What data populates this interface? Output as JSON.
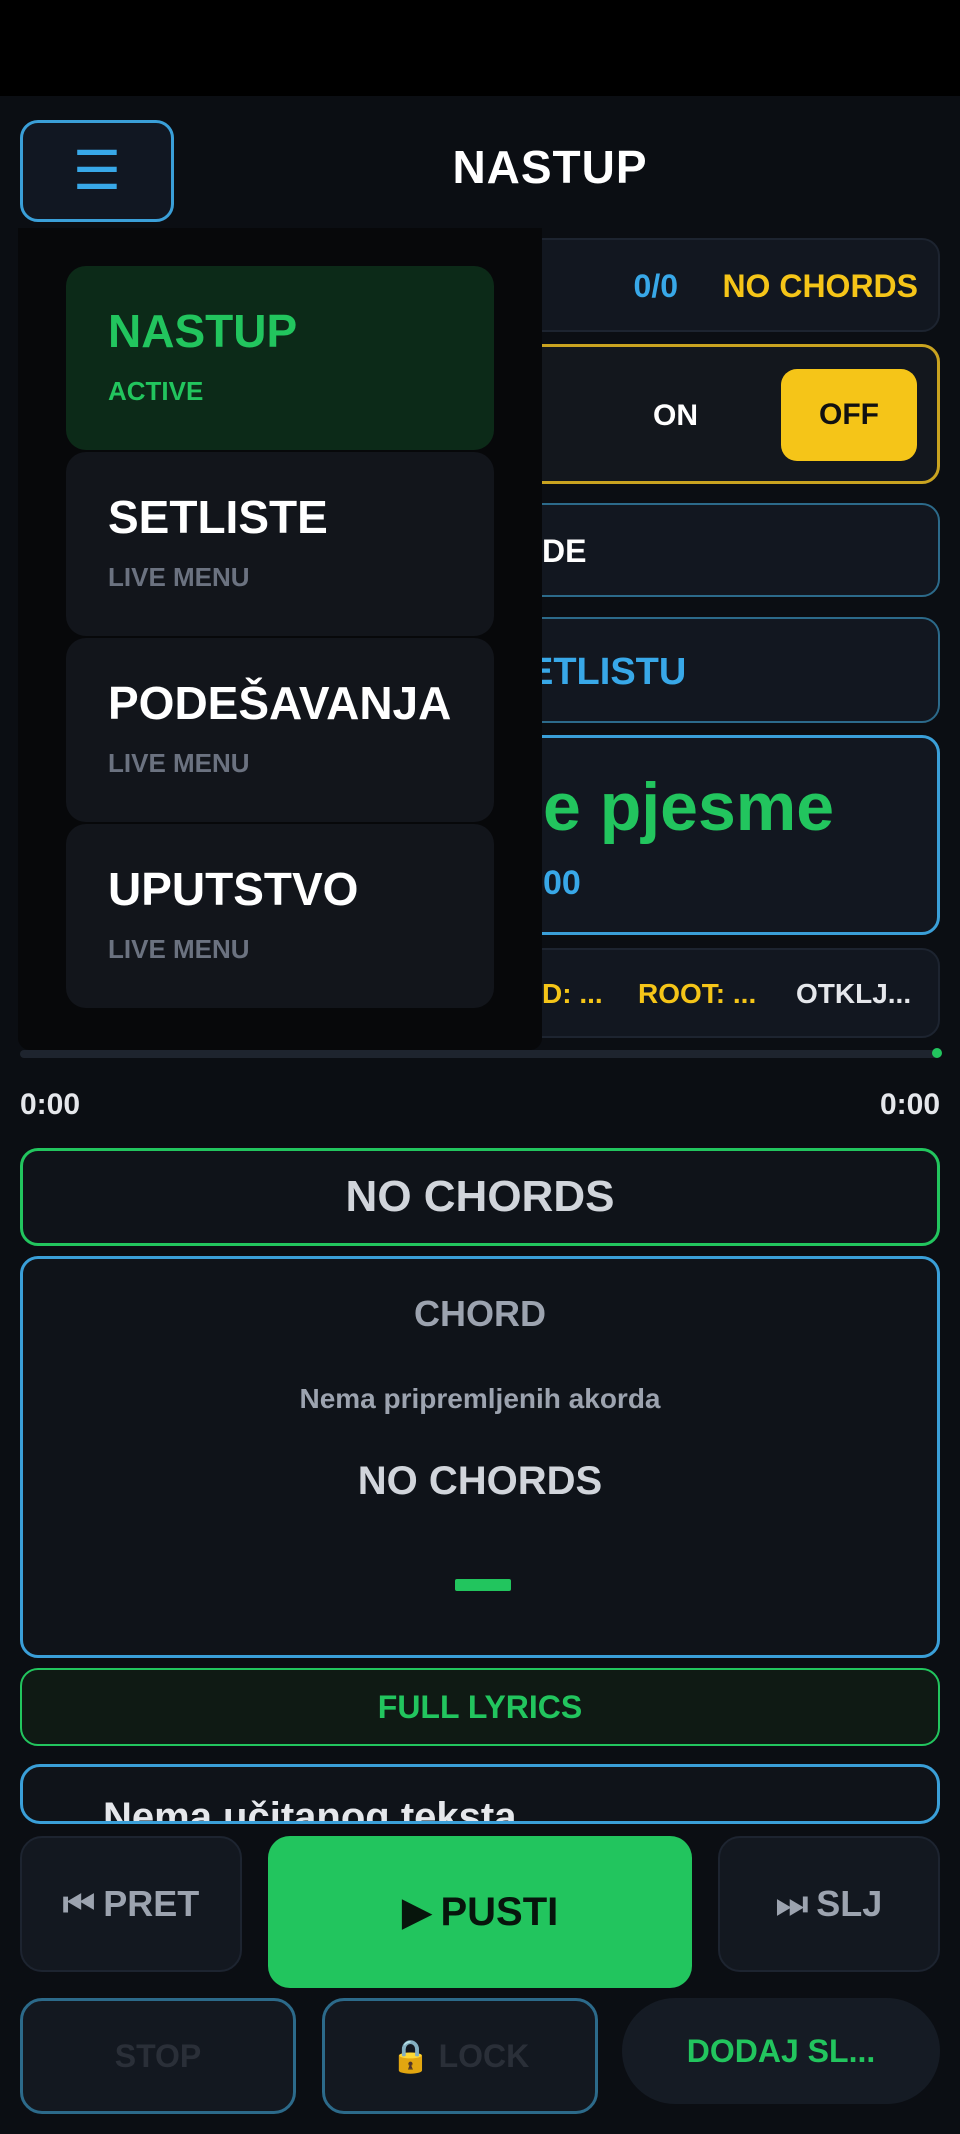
{
  "header": {
    "title": "NASTUP",
    "menu_icon": "hamburger-icon"
  },
  "status": {
    "count": "0/0",
    "no_chords": "NO CHORDS"
  },
  "toggle": {
    "on_label": "ON",
    "off_label": "OFF",
    "selected": "OFF"
  },
  "partial": {
    "mode_text": "DE",
    "setlist_text": "ETLISTU",
    "song_title_text": "e pjesme",
    "song_time_text": "00",
    "info_a": "D: ...",
    "info_b": "ROOT: ...",
    "info_c": "OTKLJ..."
  },
  "timer": {
    "current": "0:00",
    "total": "0:00"
  },
  "chords": {
    "bar_label": "NO CHORDS",
    "box_label": "CHORD",
    "box_sub": "Nema pripremljenih akorda",
    "box_big": "NO CHORDS"
  },
  "lyrics": {
    "button_label": "FULL LYRICS",
    "preview_text": "Nema učitanog teksta"
  },
  "controls": {
    "prev_label": "PRET",
    "play_label": "PUSTI",
    "next_label": "SLJ",
    "stop_label": "STOP",
    "lock_label": "LOCK",
    "add_label": "DODAJ SL..."
  },
  "drawer": {
    "items": [
      {
        "title": "NASTUP",
        "subtitle": "ACTIVE"
      },
      {
        "title": "SETLISTE",
        "subtitle": "LIVE MENU"
      },
      {
        "title": "PODEŠAVANJA",
        "subtitle": "LIVE MENU"
      },
      {
        "title": "UPUTSTVO",
        "subtitle": "LIVE MENU"
      }
    ]
  },
  "colors": {
    "accent_green": "#22c55e",
    "accent_blue": "#38a8e8",
    "accent_yellow": "#f5c518",
    "background": "#0b0e13"
  }
}
